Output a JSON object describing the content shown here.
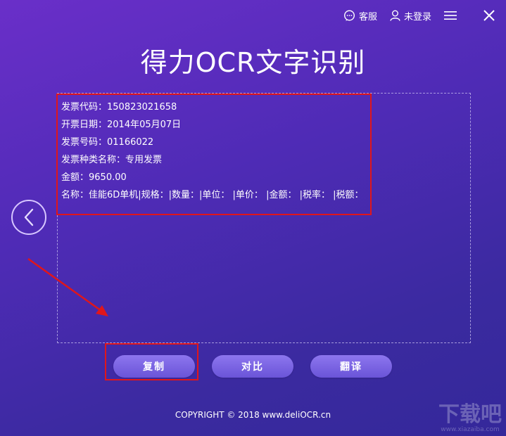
{
  "topbar": {
    "service_label": "客服",
    "login_label": "未登录"
  },
  "title": "得力OCR文字识别",
  "result_lines": [
    "发票代码：150823021658",
    "开票日期：2014年05月07日",
    "发票号码：01166022",
    "发票种类名称：专用发票",
    "金额：9650.00",
    "名称：佳能6D单机|规格：|数量：|单位： |单价： |金额： |税率： |税额："
  ],
  "buttons": {
    "copy": "复制",
    "compare": "对比",
    "translate": "翻译"
  },
  "footer": {
    "copyright": "COPYRIGHT © 2018  www.deliOCR.cn"
  },
  "watermark": {
    "big": "下载吧",
    "small": "www.xiazaiba.com"
  },
  "colors": {
    "highlight": "#e0161b",
    "button": "#7a63e3",
    "background": "#4f2bb6"
  },
  "icons": [
    "chat-icon",
    "user-icon",
    "menu-icon",
    "close-icon",
    "chevron-left-icon",
    "red-arrow"
  ]
}
